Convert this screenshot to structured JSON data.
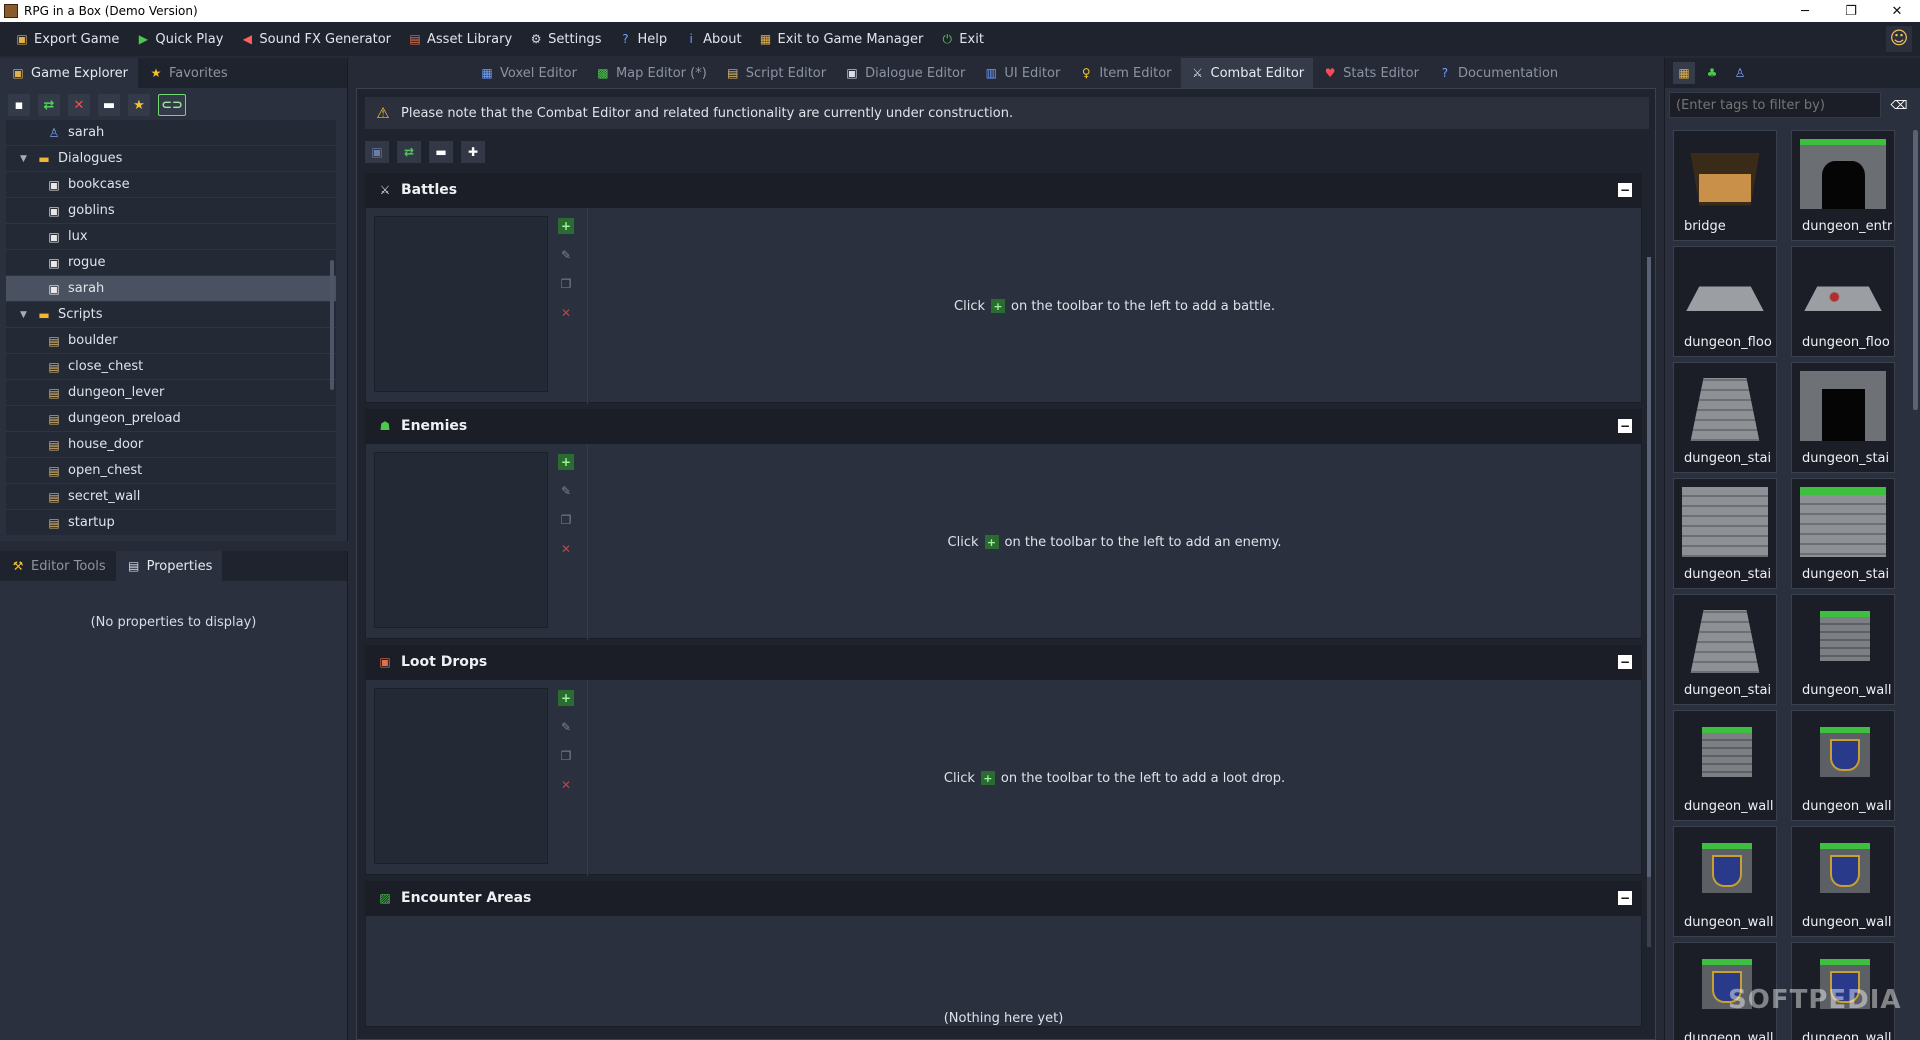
{
  "window": {
    "title": "RPG in a Box (Demo Version)",
    "minimize": "─",
    "maximize": "❐",
    "close": "✕"
  },
  "menu": [
    {
      "label": "Export Game",
      "icon": "export-icon",
      "glyph": "▣",
      "color": "#e0b050"
    },
    {
      "label": "Quick Play",
      "icon": "play-icon",
      "glyph": "▶",
      "color": "#4cc94c"
    },
    {
      "label": "Sound FX Generator",
      "icon": "speaker-icon",
      "glyph": "◀",
      "color": "#ff6060"
    },
    {
      "label": "Asset Library",
      "icon": "library-icon",
      "glyph": "▤",
      "color": "#e07050"
    },
    {
      "label": "Settings",
      "icon": "gear-icon",
      "glyph": "⚙",
      "color": "#d8dce6"
    },
    {
      "label": "Help",
      "icon": "help-icon",
      "glyph": "?",
      "color": "#6fa0ff"
    },
    {
      "label": "About",
      "icon": "info-icon",
      "glyph": "i",
      "color": "#6fa0ff"
    },
    {
      "label": "Exit to Game Manager",
      "icon": "manager-icon",
      "glyph": "▦",
      "color": "#e0b050"
    },
    {
      "label": "Exit",
      "icon": "exit-icon",
      "glyph": "⏻",
      "color": "#4cc94c"
    }
  ],
  "left": {
    "tabs": [
      {
        "label": "Game Explorer",
        "active": true
      },
      {
        "label": "Favorites",
        "active": false
      }
    ],
    "tree": [
      {
        "type": "item",
        "kind": "usr",
        "label": "sarah"
      },
      {
        "type": "folder",
        "label": "Dialogues"
      },
      {
        "type": "item",
        "kind": "dlg",
        "label": "bookcase"
      },
      {
        "type": "item",
        "kind": "dlg",
        "label": "goblins"
      },
      {
        "type": "item",
        "kind": "dlg",
        "label": "lux"
      },
      {
        "type": "item",
        "kind": "dlg",
        "label": "rogue"
      },
      {
        "type": "item",
        "kind": "dlg",
        "label": "sarah",
        "selected": true
      },
      {
        "type": "folder",
        "label": "Scripts"
      },
      {
        "type": "item",
        "kind": "scr",
        "label": "boulder"
      },
      {
        "type": "item",
        "kind": "scr",
        "label": "close_chest"
      },
      {
        "type": "item",
        "kind": "scr",
        "label": "dungeon_lever"
      },
      {
        "type": "item",
        "kind": "scr",
        "label": "dungeon_preload"
      },
      {
        "type": "item",
        "kind": "scr",
        "label": "house_door"
      },
      {
        "type": "item",
        "kind": "scr",
        "label": "open_chest"
      },
      {
        "type": "item",
        "kind": "scr",
        "label": "secret_wall"
      },
      {
        "type": "item",
        "kind": "scr",
        "label": "startup"
      }
    ],
    "bottom_tabs": [
      {
        "label": "Editor Tools",
        "active": false
      },
      {
        "label": "Properties",
        "active": true
      }
    ],
    "no_properties": "(No properties to display)"
  },
  "editor_tabs": [
    {
      "label": "Voxel Editor",
      "glyph": "▦",
      "color": "#6fa0ff"
    },
    {
      "label": "Map Editor (*)",
      "glyph": "▩",
      "color": "#4cc94c"
    },
    {
      "label": "Script Editor",
      "glyph": "▤",
      "color": "#e0b872"
    },
    {
      "label": "Dialogue Editor",
      "glyph": "▣",
      "color": "#d8dce6"
    },
    {
      "label": "UI Editor",
      "glyph": "▥",
      "color": "#6fa0ff"
    },
    {
      "label": "Item Editor",
      "glyph": "♀",
      "color": "#f2c230"
    },
    {
      "label": "Combat Editor",
      "glyph": "⚔",
      "color": "#d8dce6",
      "active": true
    },
    {
      "label": "Stats Editor",
      "glyph": "♥",
      "color": "#ff4a5a"
    },
    {
      "label": "Documentation",
      "glyph": "?",
      "color": "#6fa0ff"
    }
  ],
  "warning": "Please note that the Combat Editor and related functionality are currently under construction.",
  "sections": [
    {
      "title": "Battles",
      "glyph": "⚔",
      "color": "#d8dce6",
      "hint_before": "Click",
      "hint_after": "on the toolbar to the left to add a battle."
    },
    {
      "title": "Enemies",
      "glyph": "☗",
      "color": "#4cc94c",
      "hint_before": "Click",
      "hint_after": "on the toolbar to the left to add an enemy."
    },
    {
      "title": "Loot Drops",
      "glyph": "▣",
      "color": "#e07050",
      "hint_before": "Click",
      "hint_after": "on the toolbar to the left to add a loot drop."
    }
  ],
  "encounter": {
    "title": "Encounter Areas",
    "glyph": "▨",
    "color": "#4cc94c",
    "empty": "(Nothing here yet)"
  },
  "right": {
    "tag_placeholder": "(Enter tags to filter by)",
    "assets": [
      {
        "label": "bridge",
        "thumb": "t-bridge"
      },
      {
        "label": "dungeon_entr",
        "thumb": "t-entr"
      },
      {
        "label": "dungeon_floo",
        "thumb": "t-floor"
      },
      {
        "label": "dungeon_floo",
        "thumb": "t-floor2"
      },
      {
        "label": "dungeon_stai",
        "thumb": "t-stair"
      },
      {
        "label": "dungeon_stai",
        "thumb": "t-stair2"
      },
      {
        "label": "dungeon_stai",
        "thumb": "t-stair3"
      },
      {
        "label": "dungeon_stai",
        "thumb": "t-stair4"
      },
      {
        "label": "dungeon_stai",
        "thumb": "t-stair"
      },
      {
        "label": "dungeon_wall",
        "thumb": "t-wall"
      },
      {
        "label": "dungeon_wall",
        "thumb": "t-wall"
      },
      {
        "label": "dungeon_wall",
        "thumb": "t-banner"
      },
      {
        "label": "dungeon_wall",
        "thumb": "t-banner"
      },
      {
        "label": "dungeon_wall",
        "thumb": "t-banner"
      },
      {
        "label": "dungeon_wall",
        "thumb": "t-banner"
      },
      {
        "label": "dungeon_wall",
        "thumb": "t-banner"
      }
    ]
  },
  "watermark": "SOFTPEDIA"
}
